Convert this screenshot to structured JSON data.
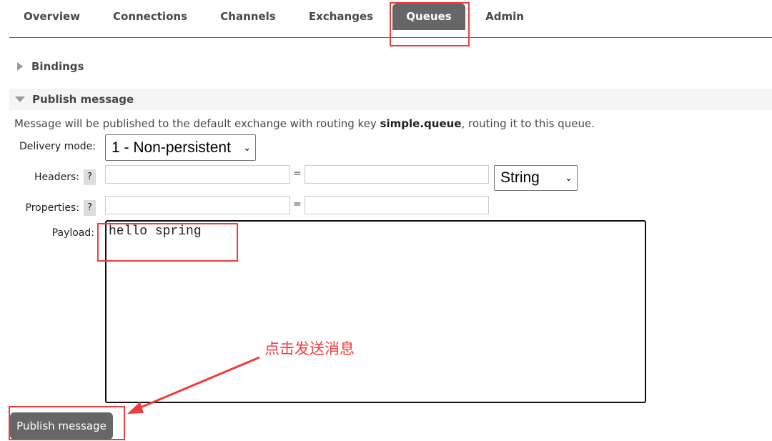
{
  "nav": {
    "tabs": [
      {
        "label": "Overview"
      },
      {
        "label": "Connections"
      },
      {
        "label": "Channels"
      },
      {
        "label": "Exchanges"
      },
      {
        "label": "Queues",
        "active": true
      },
      {
        "label": "Admin"
      }
    ]
  },
  "sections": {
    "bindings": "Bindings",
    "publish": "Publish message"
  },
  "publish": {
    "info_prefix": "Message will be published to the default exchange with routing key ",
    "routing_key": "simple.queue",
    "info_suffix": ", routing it to this queue.",
    "delivery_label": "Delivery mode:",
    "delivery_value": "1 - Non-persistent",
    "headers_label": "Headers:",
    "properties_label": "Properties:",
    "help": "?",
    "equals": "=",
    "header_type": "String",
    "payload_label": "Payload:",
    "payload_value": "hello spring",
    "button": "Publish message"
  },
  "annotation": {
    "text": "点击发送消息",
    "color": "#f03c3c"
  },
  "colors": {
    "active_tab": "#666666",
    "button": "#666666",
    "highlight": "#f03c3c"
  }
}
